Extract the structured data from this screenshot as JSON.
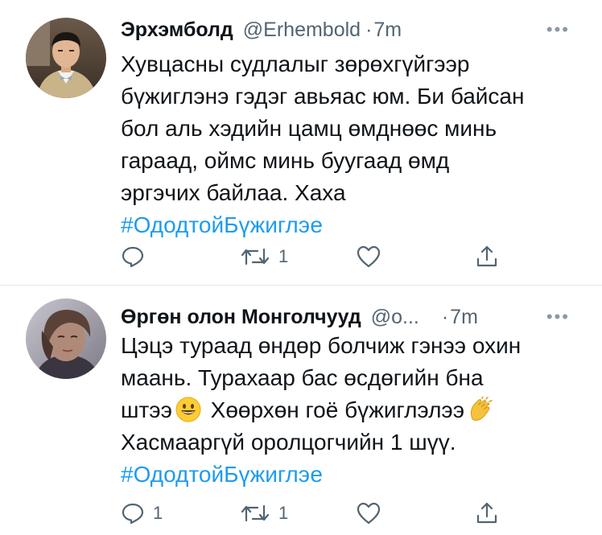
{
  "tweets": [
    {
      "author": {
        "display_name": "Эрхэмболд",
        "handle": "@Erhembold",
        "avatar_icon": "avatar-man-suit"
      },
      "separator": "·",
      "time": "7m",
      "more_label": "•••",
      "lines": [
        "Хувцасны судлалыг зөрөхгүйгээр",
        "бүжиглэнэ гэдэг авьяас юм. Би байсан",
        "бол аль хэдийн цамц өмднөөс минь",
        "гараад, оймс минь буугаад өмд",
        "эргэчих байлаа. Хаха"
      ],
      "hashtag": "#ОдодтойБүжиглэе",
      "actions": {
        "reply_count": "",
        "retweet_count": "1",
        "like_count": "",
        "icons": [
          "reply-icon",
          "retweet-icon",
          "like-icon",
          "share-icon"
        ]
      }
    },
    {
      "author": {
        "display_name": "Өргөн олон Монголчууд",
        "handle": "@о...",
        "avatar_icon": "avatar-woman-portrait"
      },
      "separator": "·",
      "time": "7m",
      "more_label": "•••",
      "lines": [
        "Цэцэ тураад өндөр болчиж гэнээ охин",
        "маань. Турахаар бас өсдөгийн бна",
        "штээ",
        "Хасмааргүй оролцогчийн 1 шүү."
      ],
      "line3_suffix": "Хөөрхөн гоё бүжиглэлээ",
      "emojis": [
        "grinning-face-emoji",
        "clapping-hands-emoji"
      ],
      "hashtag": "#ОдодтойБүжиглэе",
      "actions": {
        "reply_count": "1",
        "retweet_count": "1",
        "like_count": "",
        "icons": [
          "reply-icon",
          "retweet-icon",
          "like-icon",
          "share-icon"
        ]
      }
    }
  ],
  "colors": {
    "text": "#0f1419",
    "secondary": "#536471",
    "hashtag": "#1d9bf0",
    "divider": "#e1e8ed"
  }
}
